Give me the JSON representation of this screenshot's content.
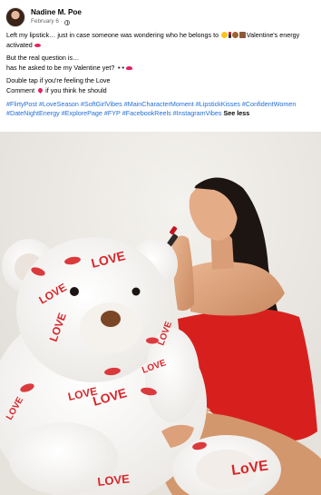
{
  "post": {
    "author": "Nadine M. Poe",
    "date": "February 6",
    "separator": "·",
    "caption": {
      "line1": "Left my lipstick… just in case someone was wondering who he belongs to",
      "line1_tail": "Valentine's energy activated",
      "line2": "But the real question is…",
      "line3": "has he asked to be my Valentine yet?",
      "line4": "Double tap if you're feeling the Love",
      "line5a": "Comment",
      "line5b": "if you think he should"
    },
    "hashtags": "#FlirtyPost #LoveSeason #SoftGirlVibes #MainCharacterMoment #LipstickKisses #ConfidentWomen #DateNightEnergy #ExplorePage #FYP #FacebookReels #InstagramVibes",
    "see_less": "See less"
  },
  "photo": {
    "bear_text": [
      "LOVE",
      "LOVE",
      "LOVE",
      "LOVE",
      "LOVE",
      "LOVE",
      "LOVE",
      "LOVE",
      "LoVE",
      "LOVE"
    ],
    "colors": {
      "dress": "#d7201e",
      "lipstick": "#c4151c",
      "link": "#216fdb",
      "background": "#efece8"
    }
  },
  "icons": [
    "globe-icon",
    "heart-icon",
    "lipstick-icon",
    "teddy-bear-icon",
    "eyes-icon",
    "kiss-icon"
  ]
}
